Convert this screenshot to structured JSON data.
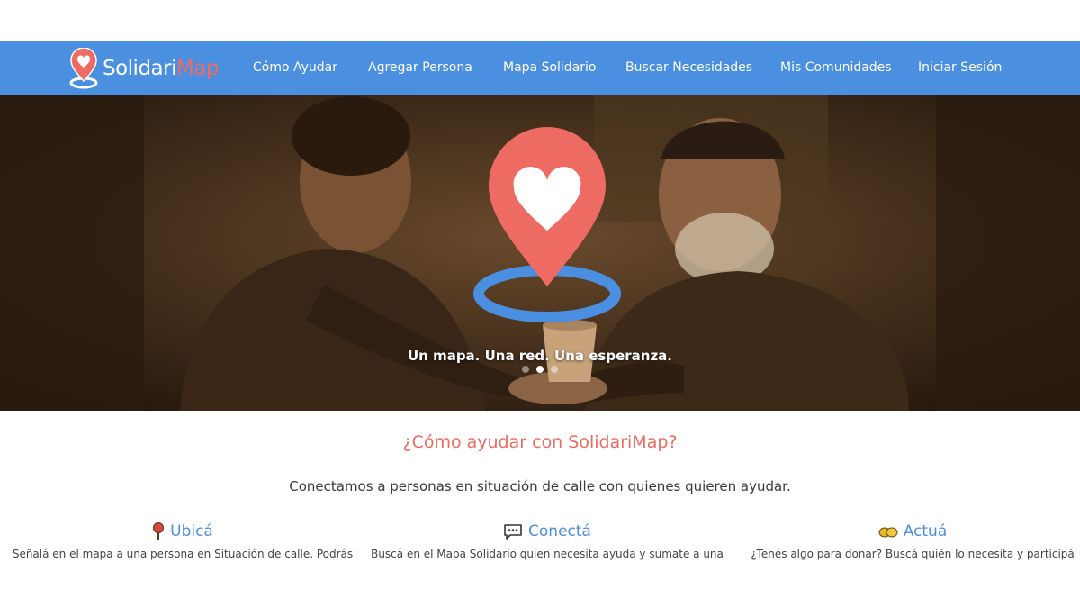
{
  "brand": {
    "name_part1": "Solidari",
    "name_part2": "Map",
    "accent": "#ee6b63",
    "primary": "#4a8fe0"
  },
  "nav": {
    "items": [
      {
        "label": "Cómo Ayudar"
      },
      {
        "label": "Agregar Persona"
      },
      {
        "label": "Mapa Solidario"
      },
      {
        "label": "Buscar Necesidades"
      },
      {
        "label": "Mis Comunidades"
      },
      {
        "label": "Iniciar Sesión"
      }
    ]
  },
  "hero": {
    "caption": "Un mapa. Una red. Una esperanza.",
    "slides_total": 3,
    "active_slide": 2
  },
  "how": {
    "title": "¿Cómo ayudar con SolidariMap?",
    "subtitle": "Conectamos a personas en situación de calle con quienes quieren ayudar.",
    "features": [
      {
        "icon": "pin-icon",
        "title": "Ubicá",
        "desc": "Señalá en el mapa a una persona en Situación de calle. Podrás"
      },
      {
        "icon": "chat-icon",
        "title": "Conectá",
        "desc": "Buscá en el Mapa Solidario quien necesita ayuda y sumate a una"
      },
      {
        "icon": "handshake-icon",
        "title": "Actuá",
        "desc": "¿Tenés algo para donar? Buscá quién lo necesita y participá"
      }
    ]
  }
}
